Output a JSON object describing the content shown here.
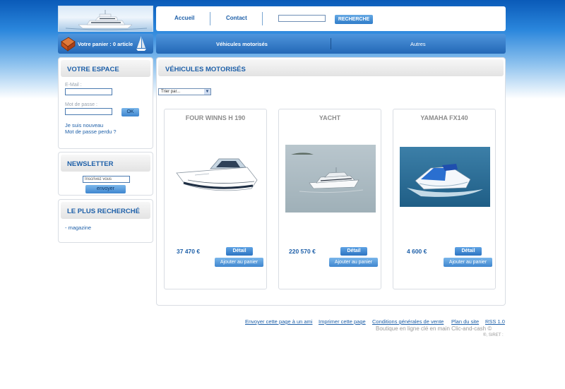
{
  "header": {
    "nav": [
      "Accueil",
      "Contact"
    ],
    "search_placeholder": "",
    "search_button": "RECHERCHE",
    "cart_text": "Votre panier : 0 article",
    "categories": [
      "Véhicules motorisés",
      "Autres"
    ]
  },
  "sidebar": {
    "account": {
      "title": "VOTRE ESPACE",
      "email_label": "E-Mail :",
      "password_label": "Mot de passe :",
      "ok_button": "OK",
      "register_link": "Je suis nouveau",
      "forgot_link": "Mot de passe perdu ?"
    },
    "newsletter": {
      "title": "NEWSLETTER",
      "input_value": "Inscrivez vous",
      "submit_button": "envoyer"
    },
    "popular": {
      "title": "LE PLUS RECHERCHÉ",
      "items": [
        "- magazine"
      ]
    }
  },
  "main": {
    "title": "VÉHICULES MOTORISÉS",
    "sort_label": "Trier par...",
    "products": [
      {
        "name": "FOUR WINNS H 190",
        "price": "37 470 €",
        "detail": "Détail",
        "add_to_cart": "Ajouter au panier"
      },
      {
        "name": "YACHT",
        "price": "220 570 €",
        "detail": "Détail",
        "add_to_cart": "Ajouter au panier"
      },
      {
        "name": "YAMAHA FX140",
        "price": "4 600 €",
        "detail": "Détail",
        "add_to_cart": "Ajouter au panier"
      }
    ]
  },
  "footer": {
    "links": [
      "Envoyer cette page à un ami",
      "Imprimer cette page",
      "Conditions générales de vente",
      "Plan du site",
      "RSS 1.0"
    ],
    "credit": "Boutique en ligne clé en main Clic-and-cash ©",
    "siret": "®, SIRET :"
  },
  "colors": {
    "accent": "#1d5fa8",
    "bar_blue": "#2f7cc9",
    "background_top": "#0a5ab8"
  }
}
